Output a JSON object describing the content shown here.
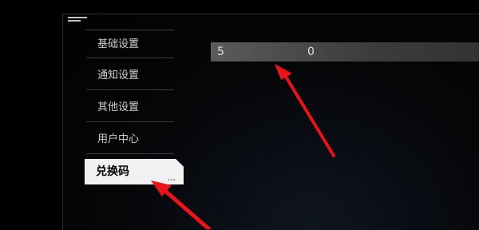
{
  "menu": {
    "items": [
      {
        "label": "基础设置"
      },
      {
        "label": "通知设置"
      },
      {
        "label": "其他设置"
      },
      {
        "label": "用户中心"
      },
      {
        "label": "兑换码",
        "more": "..."
      }
    ]
  },
  "redeem": {
    "code_char_1": "5",
    "code_char_2": "0"
  },
  "colors": {
    "arrow": "#e8141a",
    "active_item_bg": "#f2f2f2"
  }
}
